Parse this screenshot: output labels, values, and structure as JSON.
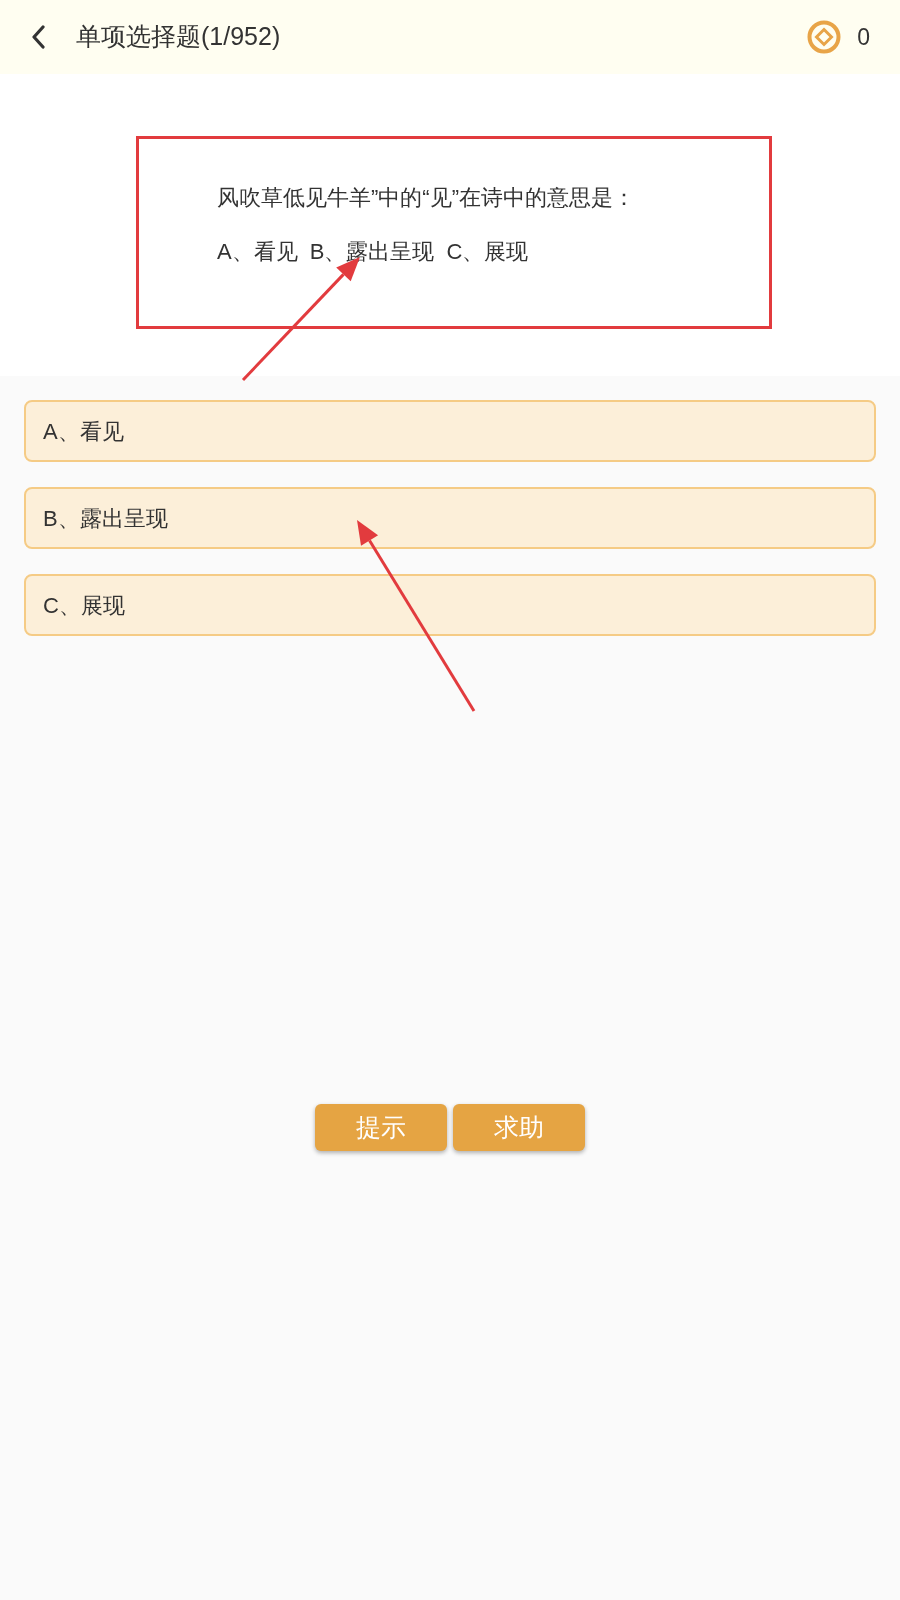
{
  "header": {
    "title": "单项选择题(1/952)",
    "coins": "0"
  },
  "question": {
    "text": "风吹草低见牛羊”中的“见”在诗中的意思是：",
    "choices_line": [
      "A、看见",
      "B、露出呈现",
      "C、展现"
    ]
  },
  "options": [
    {
      "label": "A、看见",
      "selected": false
    },
    {
      "label": "B、露出呈现",
      "selected": false
    },
    {
      "label": "C、展现",
      "selected": false
    }
  ],
  "buttons": [
    {
      "label": "提示"
    },
    {
      "label": "求助"
    }
  ]
}
